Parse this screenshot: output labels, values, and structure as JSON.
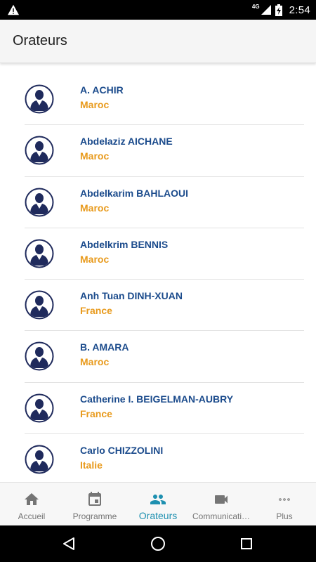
{
  "status_bar": {
    "time": "2:54",
    "network": "4G"
  },
  "app_bar": {
    "title": "Orateurs"
  },
  "speakers": [
    {
      "name": "A. ACHIR",
      "country": "Maroc"
    },
    {
      "name": "Abdelaziz AICHANE",
      "country": "Maroc"
    },
    {
      "name": "Abdelkarim BAHLAOUI",
      "country": "Maroc"
    },
    {
      "name": "Abdelkrim BENNIS",
      "country": "Maroc"
    },
    {
      "name": "Anh Tuan DINH-XUAN",
      "country": "France"
    },
    {
      "name": "B. AMARA",
      "country": "Maroc"
    },
    {
      "name": "Catherine I. BEIGELMAN-AUBRY",
      "country": "France"
    },
    {
      "name": "Carlo CHIZZOLINI",
      "country": "Italie"
    }
  ],
  "bottom_nav": [
    {
      "label": "Accueil",
      "icon": "home-icon",
      "active": false
    },
    {
      "label": "Programme",
      "icon": "calendar-icon",
      "active": false
    },
    {
      "label": "Orateurs",
      "icon": "people-icon",
      "active": true
    },
    {
      "label": "Communicati…",
      "icon": "video-camera-icon",
      "active": false
    },
    {
      "label": "Plus",
      "icon": "more-dots-icon",
      "active": false
    }
  ],
  "colors": {
    "name": "#1b4b8c",
    "country": "#e89a1c",
    "active_tab": "#1e90b0",
    "inactive_tab": "#757575",
    "avatar": "#1f2a5c"
  }
}
